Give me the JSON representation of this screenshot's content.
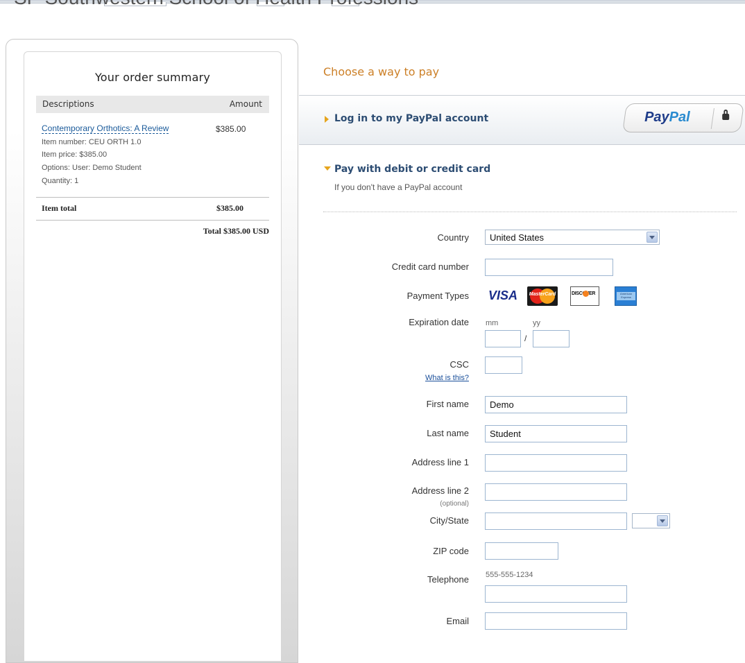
{
  "site": {
    "title": "SP Southwestern School of Health Professions"
  },
  "order_summary": {
    "title": "Your order summary",
    "col_desc": "Descriptions",
    "col_amount": "Amount",
    "item": {
      "name": "Contemporary Orthotics: A Review",
      "amount": "$385.00",
      "number": "Item number: CEU ORTH 1.0",
      "price": "Item price: $385.00",
      "options": "Options: User: Demo Student",
      "quantity": "Quantity: 1"
    },
    "item_total_label": "Item total",
    "item_total_value": "$385.00",
    "grand_total": "Total $385.00 USD"
  },
  "payment": {
    "title": "Choose a way to pay",
    "login_label": "Log in to my PayPal account",
    "paypal_logo": {
      "pay": "Pay",
      "pal": "Pal",
      "icon": "lock-icon"
    },
    "card_label": "Pay with debit or credit card",
    "card_sub": "If you don't have a PayPal account",
    "accent_color": "#cc7f26",
    "link_color": "#2d4d73"
  },
  "form": {
    "country_label": "Country",
    "country_value": "United States",
    "cc_label": "Credit card number",
    "cc_value": "",
    "payment_types_label": "Payment Types",
    "payment_types": [
      "VISA",
      "MasterCard",
      "DISCOVER",
      "American Express"
    ],
    "exp_label": "Expiration date",
    "exp_mm": "mm",
    "exp_yy": "yy",
    "exp_sep": "/",
    "csc_label": "CSC",
    "csc_help": "What is this?",
    "first_label": "First name",
    "first_value": "Demo",
    "last_label": "Last name",
    "last_value": "Student",
    "addr1_label": "Address line 1",
    "addr2_label": "Address line 2",
    "optional": "(optional)",
    "city_label": "City/State",
    "zip_label": "ZIP code",
    "phone_label": "Telephone",
    "phone_hint": "555-555-1234",
    "email_label": "Email"
  }
}
